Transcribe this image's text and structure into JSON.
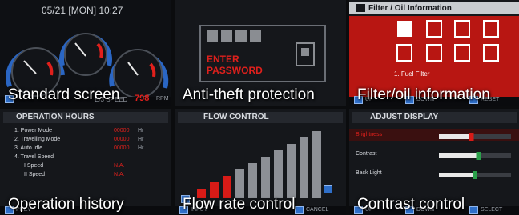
{
  "tiles": [
    {
      "caption": "Standard screen",
      "header": "05/21 [MON] 10:27",
      "bottom_left": "E/3 SPEED",
      "bottom_value": "798",
      "bottom_unit": "RPM"
    },
    {
      "caption": "Anti-theft protection",
      "line1": "ENTER",
      "line2": "PASSWORD"
    },
    {
      "caption": "Filter/oil information",
      "title": "Filter / Oil Information",
      "item": "1. Fuel Filter",
      "btn_up": "UP",
      "btn_down": "DOWN",
      "btn_reset": "RESET"
    },
    {
      "caption": "Operation history",
      "title": "OPERATION HOURS",
      "rows": [
        {
          "label": "1. Power Mode",
          "value": "00000",
          "unit": "Hr"
        },
        {
          "label": "2. Travelling Mode",
          "value": "00000",
          "unit": "Hr"
        },
        {
          "label": "3. Auto Idle",
          "value": "00000",
          "unit": "Hr"
        },
        {
          "label": "4. Travel Speed",
          "value": "",
          "unit": ""
        },
        {
          "label": "I Speed",
          "value": "N.A.",
          "unit": ""
        },
        {
          "label": "II Speed",
          "value": "N.A.",
          "unit": ""
        }
      ],
      "btn_prev": "PREV"
    },
    {
      "caption": "Flow rate control",
      "title": "FLOW CONTROL",
      "btn_input": "INPUT",
      "btn_cancel": "CANCEL",
      "levels": 10,
      "selected_level": 3
    },
    {
      "caption": "Contrast control",
      "title": "ADJUST DISPLAY",
      "rows": [
        {
          "label": "Brightness",
          "level": 0.45
        },
        {
          "label": "Contrast",
          "level": 0.55
        },
        {
          "label": "Back Light",
          "level": 0.5
        }
      ],
      "btn_up": "UP",
      "btn_down": "DOWN",
      "btn_select": "SELECT"
    }
  ]
}
